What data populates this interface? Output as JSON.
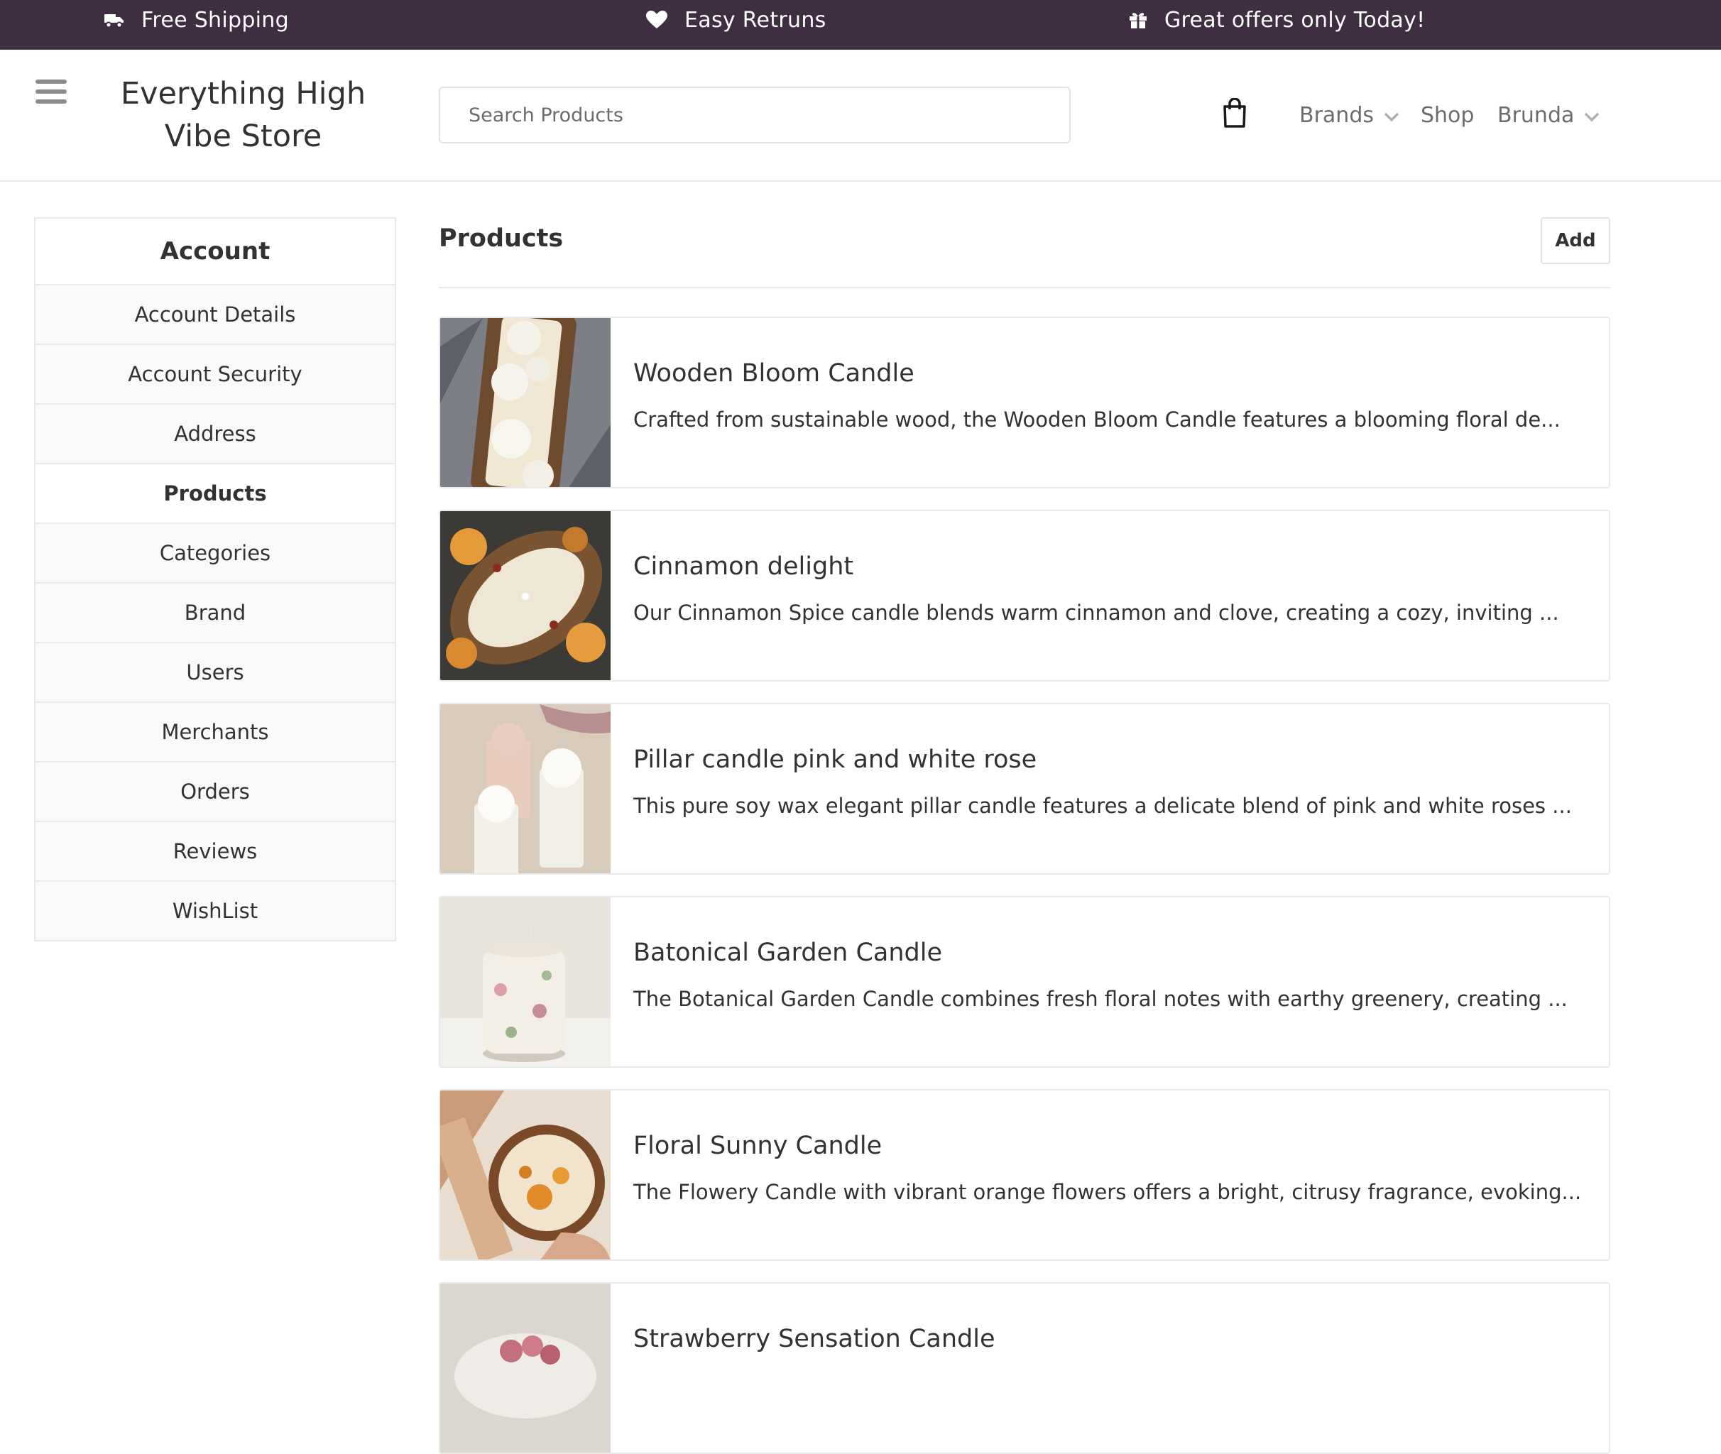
{
  "topbar": {
    "items": [
      {
        "icon": "truck-icon",
        "label": "Free Shipping"
      },
      {
        "icon": "heart-icon",
        "label": "Easy Retruns"
      },
      {
        "icon": "gift-icon",
        "label": "Great offers only Today!"
      }
    ]
  },
  "header": {
    "store_name": "Everything High Vibe Store",
    "search_placeholder": "Search Products",
    "nav": {
      "brands": "Brands",
      "shop": "Shop",
      "user": "Brunda"
    }
  },
  "sidebar": {
    "title": "Account",
    "items": [
      {
        "label": "Account Details"
      },
      {
        "label": "Account Security"
      },
      {
        "label": "Address"
      },
      {
        "label": "Products",
        "active": true
      },
      {
        "label": "Categories"
      },
      {
        "label": "Brand"
      },
      {
        "label": "Users"
      },
      {
        "label": "Merchants"
      },
      {
        "label": "Orders"
      },
      {
        "label": "Reviews"
      },
      {
        "label": "WishList"
      }
    ]
  },
  "main": {
    "title": "Products",
    "add_label": "Add",
    "products": [
      {
        "name": "Wooden Bloom Candle",
        "description": "Crafted from sustainable wood, the Wooden Bloom Candle features a blooming floral de...",
        "image": "wooden-bloom-candle-image"
      },
      {
        "name": "Cinnamon delight",
        "description": "Our Cinnamon Spice candle blends warm cinnamon and clove, creating a cozy, inviting ...",
        "image": "cinnamon-delight-candle-image"
      },
      {
        "name": "Pillar candle pink and white rose",
        "description": "This pure soy wax elegant pillar candle features a delicate blend of pink and white roses ...",
        "image": "pillar-rose-candle-image"
      },
      {
        "name": "Batonical Garden Candle",
        "description": "The Botanical Garden Candle combines fresh floral notes with earthy greenery, creating ...",
        "image": "botanical-garden-candle-image"
      },
      {
        "name": "Floral Sunny Candle",
        "description": "The Flowery Candle with vibrant orange flowers offers a bright, citrusy fragrance, evoking...",
        "image": "floral-sunny-candle-image"
      },
      {
        "name": "Strawberry Sensation Candle",
        "description": "",
        "image": "strawberry-sensation-candle-image"
      }
    ]
  },
  "colors": {
    "topbar_bg": "#3f2e41",
    "text": "#323232",
    "muted": "#6c6c6c",
    "border": "#e9e9e9",
    "sidebar_bg": "#f8f9fa"
  }
}
